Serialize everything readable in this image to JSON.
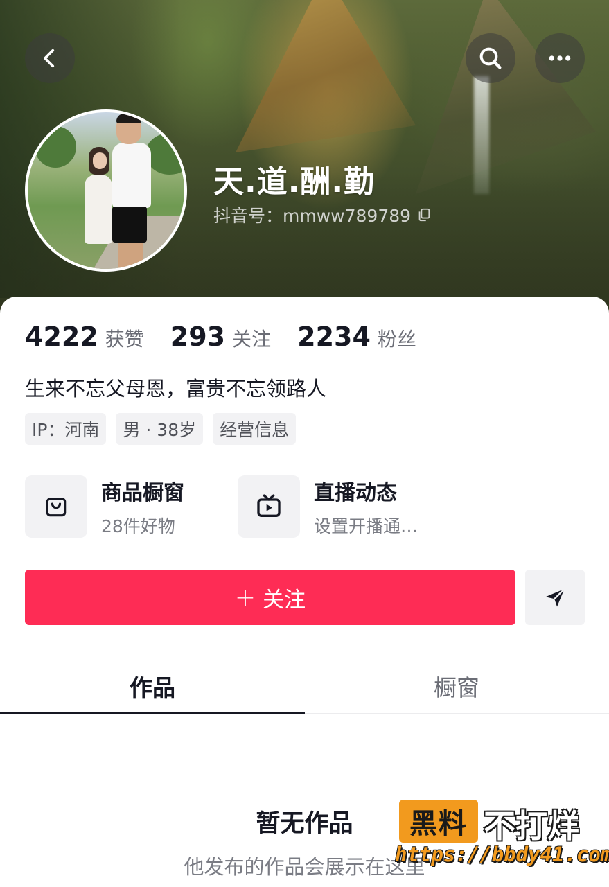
{
  "profile": {
    "nickname": "天.道.酬.勤",
    "douyin_id": "抖音号：mmww789789",
    "bio": "生来不忘父母恩，富贵不忘领路人"
  },
  "stats": [
    {
      "value": "4222",
      "label": "获赞"
    },
    {
      "value": "293",
      "label": "关注"
    },
    {
      "value": "2234",
      "label": "粉丝"
    }
  ],
  "tags": [
    "IP：河南",
    "男 · 38岁",
    "经营信息"
  ],
  "entries": {
    "shop": {
      "title": "商品橱窗",
      "subtitle": "28件好物",
      "icon": "shopping-bag-icon"
    },
    "live": {
      "title": "直播动态",
      "subtitle": "设置开播通…",
      "icon": "tv-icon"
    }
  },
  "actions": {
    "follow_plus": "+",
    "follow_label": "关注"
  },
  "tabs": [
    {
      "label": "作品",
      "active": true
    },
    {
      "label": "橱窗",
      "active": false
    }
  ],
  "empty_state": {
    "title": "暂无作品",
    "subtitle": "他发布的作品会展示在这里"
  },
  "watermark": {
    "box": "黑料",
    "word": "不打烊",
    "url": "https://bbdy41.com"
  },
  "colors": {
    "accent": "#fe2c55",
    "text": "#161823",
    "muted": "#6b6d76",
    "chip_bg": "#f2f2f4"
  }
}
